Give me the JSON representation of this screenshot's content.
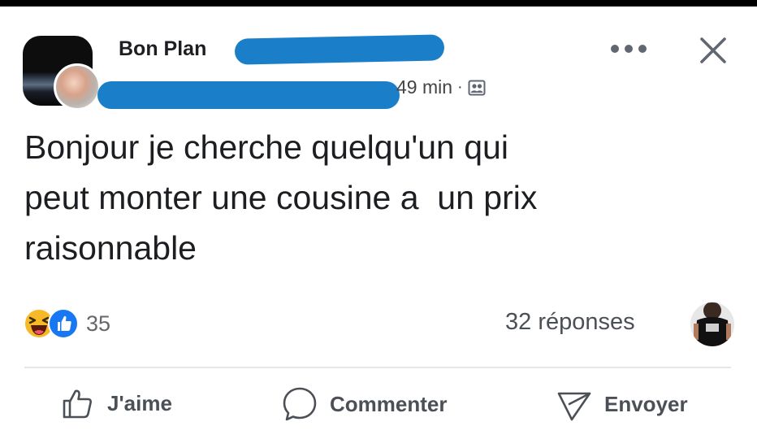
{
  "post": {
    "group_name": "Bon Plan",
    "time": "49 min",
    "separator": "·",
    "text": "Bonjour je cherche quelqu'un qui\npeut monter une cousine a  un prix\nraisonnable",
    "reactions": {
      "types": [
        "haha-icon",
        "like-icon"
      ],
      "count": "35"
    },
    "replies_label": "32 réponses"
  },
  "actions": {
    "like_label": "J'aime",
    "comment_label": "Commenter",
    "send_label": "Envoyer"
  },
  "colors": {
    "redaction": "#1a7fc8",
    "like_blue": "#1877f2",
    "haha_yellow": "#f7b928",
    "text": "#1c1e21",
    "secondary_text": "#65676b"
  }
}
